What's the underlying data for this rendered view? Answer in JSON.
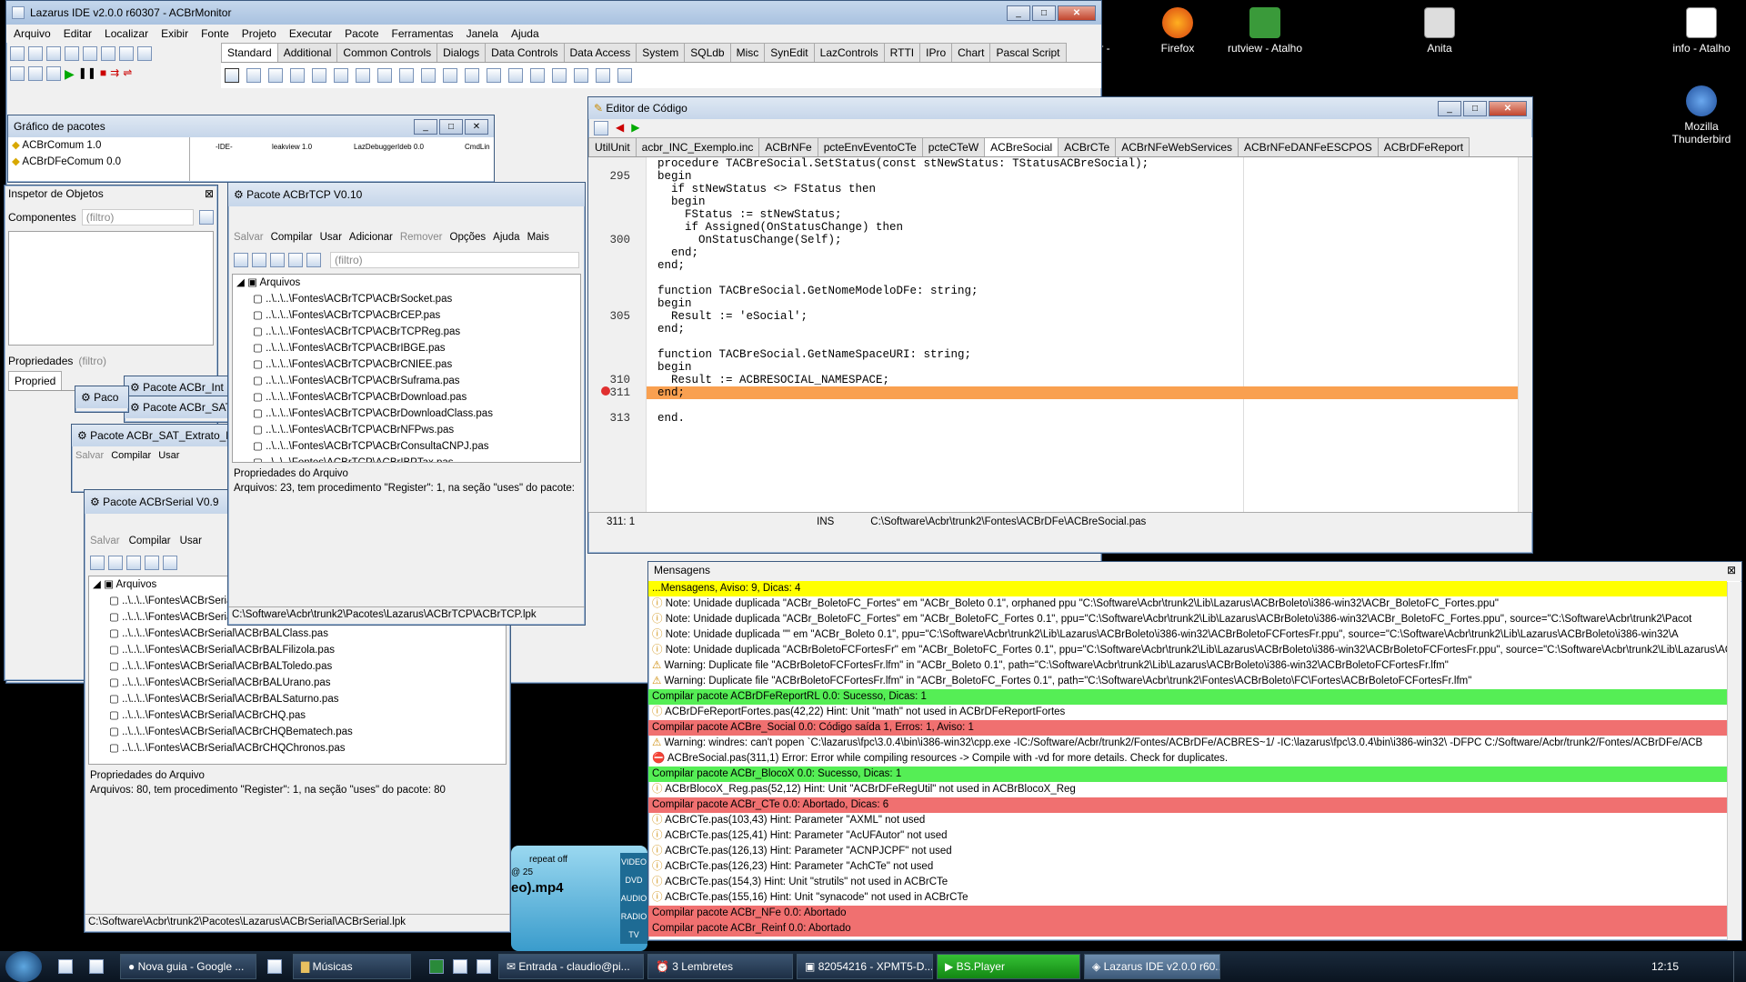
{
  "desktop": {
    "icons": [
      {
        "label": "tor -"
      },
      {
        "label": "Firefox"
      },
      {
        "label": "rutview - Atalho"
      },
      {
        "label": "Anita"
      },
      {
        "label": "info - Atalho"
      },
      {
        "label": "Mozilla Thunderbird"
      }
    ]
  },
  "ide": {
    "title": "Lazarus IDE v2.0.0 r60307 - ACBrMonitor",
    "menu": [
      "Arquivo",
      "Editar",
      "Localizar",
      "Exibir",
      "Fonte",
      "Projeto",
      "Executar",
      "Pacote",
      "Ferramentas",
      "Janela",
      "Ajuda"
    ],
    "palette_tabs": [
      "Standard",
      "Additional",
      "Common Controls",
      "Dialogs",
      "Data Controls",
      "Data Access",
      "System",
      "SQLdb",
      "Misc",
      "SynEdit",
      "LazControls",
      "RTTI",
      "IPro",
      "Chart",
      "Pascal Script"
    ]
  },
  "graph": {
    "title": "Gráfico de pacotes",
    "items": [
      "ACBrComum 1.0",
      "ACBrDFeComum 0.0"
    ],
    "nodes": [
      "-IDE-",
      "leakview 1.0",
      "LazDebuggerIdeb 0.0",
      "CmdLin"
    ]
  },
  "inspector": {
    "title": "Inspetor de Objetos",
    "components_label": "Componentes",
    "filter": "(filtro)",
    "props_label": "Propriedades",
    "props_tab": "Propried"
  },
  "tcp": {
    "title": "Pacote ACBrTCP V0.10",
    "tools": [
      "Salvar",
      "Compilar",
      "Usar",
      "Adicionar",
      "Remover",
      "Opções",
      "Ajuda",
      "Mais"
    ],
    "filter": "(filtro)",
    "root": "Arquivos",
    "files": [
      "..\\..\\..\\Fontes\\ACBrTCP\\ACBrSocket.pas",
      "..\\..\\..\\Fontes\\ACBrTCP\\ACBrCEP.pas",
      "..\\..\\..\\Fontes\\ACBrTCP\\ACBrTCPReg.pas",
      "..\\..\\..\\Fontes\\ACBrTCP\\ACBrIBGE.pas",
      "..\\..\\..\\Fontes\\ACBrTCP\\ACBrCNIEE.pas",
      "..\\..\\..\\Fontes\\ACBrTCP\\ACBrSuframa.pas",
      "..\\..\\..\\Fontes\\ACBrTCP\\ACBrDownload.pas",
      "..\\..\\..\\Fontes\\ACBrTCP\\ACBrDownloadClass.pas",
      "..\\..\\..\\Fontes\\ACBrTCP\\ACBrNFPws.pas",
      "..\\..\\..\\Fontes\\ACBrTCP\\ACBrConsultaCNPJ.pas",
      "..\\..\\..\\Fontes\\ACBrTCP\\ACBrIBPTax.pas"
    ],
    "props_title": "Propriedades do Arquivo",
    "props_text": "Arquivos: 23, tem procedimento \"Register\": 1, na seção \"uses\" do pacote:",
    "status": "C:\\Software\\Acbr\\trunk2\\Pacotes\\Lazarus\\ACBrTCP\\ACBrTCP.lpk"
  },
  "stack": {
    "t1": "Pacote ACBr_Int",
    "t2": "Pacote ACBr_SAT",
    "t3": "Pacote ACBr_SAT_Extrato_F",
    "pac": "Paco"
  },
  "serial": {
    "title": "Pacote ACBrSerial V0.9",
    "root": "Arquivos",
    "files": [
      "..\\..\\..\\Fontes\\ACBrSerial\\ACBrDevice.pas",
      "..\\..\\..\\Fontes\\ACBrSerial\\ACBrBAL.pas",
      "..\\..\\..\\Fontes\\ACBrSerial\\ACBrBALClass.pas",
      "..\\..\\..\\Fontes\\ACBrSerial\\ACBrBALFilizola.pas",
      "..\\..\\..\\Fontes\\ACBrSerial\\ACBrBALToledo.pas",
      "..\\..\\..\\Fontes\\ACBrSerial\\ACBrBALUrano.pas",
      "..\\..\\..\\Fontes\\ACBrSerial\\ACBrBALSaturno.pas",
      "..\\..\\..\\Fontes\\ACBrSerial\\ACBrCHQ.pas",
      "..\\..\\..\\Fontes\\ACBrSerial\\ACBrCHQBematech.pas",
      "..\\..\\..\\Fontes\\ACBrSerial\\ACBrCHQChronos.pas"
    ],
    "props_title": "Propriedades do Arquivo",
    "props_text": "Arquivos: 80, tem procedimento \"Register\": 1, na seção \"uses\" do pacote: 80",
    "status": "C:\\Software\\Acbr\\trunk2\\Pacotes\\Lazarus\\ACBrSerial\\ACBrSerial.lpk"
  },
  "editor": {
    "title": "Editor de Código",
    "tabs": [
      "UtilUnit",
      "acbr_INC_Exemplo.inc",
      "ACBrNFe",
      "pcteEnvEventoCTe",
      "pcteCTeW",
      "ACBreSocial",
      "ACBrCTe",
      "ACBrNFeWebServices",
      "ACBrNFeDANFeESCPOS",
      "ACBrDFeReport"
    ],
    "lines": [
      {
        "n": "",
        "t": "procedure TACBreSocial.SetStatus(const stNewStatus: TStatusACBreSocial);"
      },
      {
        "n": "295",
        "t": "begin"
      },
      {
        "n": "",
        "t": "  if stNewStatus <> FStatus then"
      },
      {
        "n": "",
        "t": "  begin"
      },
      {
        "n": "",
        "t": "    FStatus := stNewStatus;"
      },
      {
        "n": "",
        "t": "    if Assigned(OnStatusChange) then"
      },
      {
        "n": "300",
        "t": "      OnStatusChange(Self);"
      },
      {
        "n": "",
        "t": "  end;"
      },
      {
        "n": "",
        "t": "end;"
      },
      {
        "n": "",
        "t": ""
      },
      {
        "n": "",
        "t": "function TACBreSocial.GetNomeModeloDFe: string;"
      },
      {
        "n": "",
        "t": "begin"
      },
      {
        "n": "305",
        "t": "  Result := 'eSocial';"
      },
      {
        "n": "",
        "t": "end;"
      },
      {
        "n": "",
        "t": ""
      },
      {
        "n": "",
        "t": "function TACBreSocial.GetNameSpaceURI: string;"
      },
      {
        "n": "",
        "t": "begin"
      },
      {
        "n": "310",
        "t": "  Result := ACBRESOCIAL_NAMESPACE;"
      },
      {
        "n": "311",
        "t": "end;"
      },
      {
        "n": "",
        "t": ""
      },
      {
        "n": "313",
        "t": "end."
      }
    ],
    "status": {
      "pos": "311: 1",
      "mode": "INS",
      "file": "C:\\Software\\Acbr\\trunk2\\Fontes\\ACBrDFe\\ACBreSocial.pas"
    }
  },
  "messages": {
    "title": "Mensagens",
    "rows": [
      {
        "c": "y",
        "t": "...Mensagens, Aviso: 9, Dicas: 4"
      },
      {
        "c": "",
        "t": "Note: Unidade duplicada \"ACBr_BoletoFC_Fortes\" em \"ACBr_Boleto 0.1\", orphaned ppu \"C:\\Software\\Acbr\\trunk2\\Lib\\Lazarus\\ACBrBoleto\\i386-win32\\ACBr_BoletoFC_Fortes.ppu\""
      },
      {
        "c": "",
        "t": "Note: Unidade duplicada \"ACBr_BoletoFC_Fortes\" em \"ACBr_BoletoFC_Fortes 0.1\", ppu=\"C:\\Software\\Acbr\\trunk2\\Lib\\Lazarus\\ACBrBoleto\\i386-win32\\ACBr_BoletoFC_Fortes.ppu\", source=\"C:\\Software\\Acbr\\trunk2\\Pacot"
      },
      {
        "c": "",
        "t": "Note: Unidade duplicada \"\" em \"ACBr_Boleto 0.1\", ppu=\"C:\\Software\\Acbr\\trunk2\\Lib\\Lazarus\\ACBrBoleto\\i386-win32\\ACBrBoletoFCFortesFr.ppu\", source=\"C:\\Software\\Acbr\\trunk2\\Lib\\Lazarus\\ACBrBoleto\\i386-win32\\A"
      },
      {
        "c": "",
        "t": "Note: Unidade duplicada \"ACBrBoletoFCFortesFr\" em \"ACBr_BoletoFC_Fortes 0.1\", ppu=\"C:\\Software\\Acbr\\trunk2\\Lib\\Lazarus\\ACBrBoleto\\i386-win32\\ACBrBoletoFCFortesFr.ppu\", source=\"C:\\Software\\Acbr\\trunk2\\Lib\\Lazarus\\ACBrBoleto\\i386-win32\\A"
      },
      {
        "c": "",
        "t": "Warning: Duplicate file \"ACBrBoletoFCFortesFr.lfm\" in \"ACBr_Boleto 0.1\", path=\"C:\\Software\\Acbr\\trunk2\\Lib\\Lazarus\\ACBrBoleto\\i386-win32\\ACBrBoletoFCFortesFr.lfm\""
      },
      {
        "c": "",
        "t": "Warning: Duplicate file \"ACBrBoletoFCFortesFr.lfm\" in \"ACBr_BoletoFC_Fortes 0.1\", path=\"C:\\Software\\Acbr\\trunk2\\Fontes\\ACBrBoleto\\FC\\Fortes\\ACBrBoletoFCFortesFr.lfm\""
      },
      {
        "c": "g",
        "t": "Compilar pacote ACBrDFeReportRL 0.0: Sucesso, Dicas: 1"
      },
      {
        "c": "",
        "t": "ACBrDFeReportFortes.pas(42,22) Hint: Unit \"math\" not used in ACBrDFeReportFortes"
      },
      {
        "c": "r",
        "t": "Compilar pacote ACBre_Social 0.0: Código saída 1, Erros: 1, Aviso: 1"
      },
      {
        "c": "",
        "t": "Warning: windres: can't popen `C:\\lazarus\\fpc\\3.0.4\\bin\\i386-win32\\cpp.exe -IC:/Software/Acbr/trunk2/Fontes/ACBrDFe/ACBRES~1/ -IC:\\lazarus\\fpc\\3.0.4\\bin\\i386-win32\\ -DFPC C:/Software/Acbr/trunk2/Fontes/ACBrDFe/ACB"
      },
      {
        "c": "",
        "t": "ACBreSocial.pas(311,1) Error: Error while compiling resources -> Compile with -vd for more details. Check for duplicates."
      },
      {
        "c": "g",
        "t": "Compilar pacote ACBr_BlocoX 0.0: Sucesso, Dicas: 1"
      },
      {
        "c": "",
        "t": "ACBrBlocoX_Reg.pas(52,12) Hint: Unit \"ACBrDFeRegUtil\" not used in ACBrBlocoX_Reg"
      },
      {
        "c": "r",
        "t": "Compilar pacote ACBr_CTe 0.0: Abortado, Dicas: 6"
      },
      {
        "c": "",
        "t": "ACBrCTe.pas(103,43) Hint: Parameter \"AXML\" not used"
      },
      {
        "c": "",
        "t": "ACBrCTe.pas(125,41) Hint: Parameter \"AcUFAutor\" not used"
      },
      {
        "c": "",
        "t": "ACBrCTe.pas(126,13) Hint: Parameter \"ACNPJCPF\" not used"
      },
      {
        "c": "",
        "t": "ACBrCTe.pas(126,23) Hint: Parameter \"AchCTe\" not used"
      },
      {
        "c": "",
        "t": "ACBrCTe.pas(154,3) Hint: Unit \"strutils\" not used in ACBrCTe"
      },
      {
        "c": "",
        "t": "ACBrCTe.pas(155,16) Hint: Unit \"synacode\" not used in ACBrCTe"
      },
      {
        "c": "r",
        "t": "Compilar pacote ACBr_NFe 0.0: Abortado"
      },
      {
        "c": "r",
        "t": "Compilar pacote ACBr_Reinf 0.0: Abortado"
      }
    ]
  },
  "player": {
    "repeat": "repeat off",
    "file": "eo).mp4",
    "time": "@ 25",
    "side": [
      "VIDEO",
      "DVD",
      "AUDIO",
      "RADIO",
      "TV"
    ]
  },
  "taskbar": {
    "items": [
      "Nova guia - Google ...",
      "Músicas",
      "Entrada - claudio@pi...",
      "3 Lembretes",
      "82054216 - XPMT5-D...",
      "BS.Player",
      "Lazarus IDE v2.0.0 r60..."
    ],
    "clock": "12:15"
  }
}
